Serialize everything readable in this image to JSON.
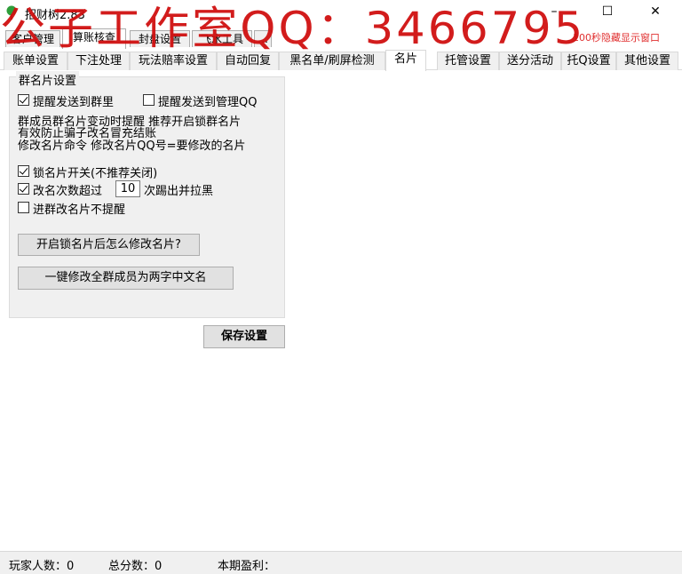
{
  "window": {
    "title": "招财树2.83",
    "minimize_glyph": "–",
    "maximize_glyph": "☐",
    "close_glyph": "✕",
    "watermark": "公子工作室QQ：3466795",
    "hint_text": "100秒隐藏显示窗口",
    "app_icon": "tree-icon"
  },
  "top_tabs": [
    "客户管理",
    "算账核查",
    "封盘设置",
    "飞水工具",
    "…"
  ],
  "sub_tabs": [
    "账单设置",
    "下注处理",
    "玩法赔率设置",
    "自动回复",
    "黑名单/刷屏检测",
    "名片",
    "托管设置",
    "送分活动",
    "托Q设置",
    "其他设置"
  ],
  "active_sub_tab": "名片",
  "group": {
    "title": "群名片设置",
    "notify_group": {
      "label": "提醒发送到群里",
      "checked": true
    },
    "notify_admin": {
      "label": "提醒发送到管理QQ",
      "checked": false
    },
    "desc_line1": "群成员群名片变动时提醒  推荐开启锁群名片",
    "desc_line2": "有效防止骗子改名冒充结账",
    "desc_line3": "修改名片命令  修改名片QQ号=要修改的名片",
    "lock_card": {
      "label": "锁名片开关(不推荐关闭)",
      "checked": true
    },
    "rename_limit": {
      "label_before": "改名次数超过",
      "value": "10",
      "label_after": "次踢出并拉黑",
      "checked": true
    },
    "no_remind": {
      "label": "进群改名片不提醒",
      "checked": false
    },
    "help_button": "开启锁名片后怎么修改名片?",
    "bulk_button": "一键修改全群成员为两字中文名"
  },
  "save_button": "保存设置",
  "status": {
    "players": "玩家人数：0",
    "total_points": "总分数：0",
    "profit": "本期盈利："
  },
  "colors": {
    "watermark": "#d01010",
    "hint": "#e03030",
    "panel": "#f0f0f0"
  }
}
